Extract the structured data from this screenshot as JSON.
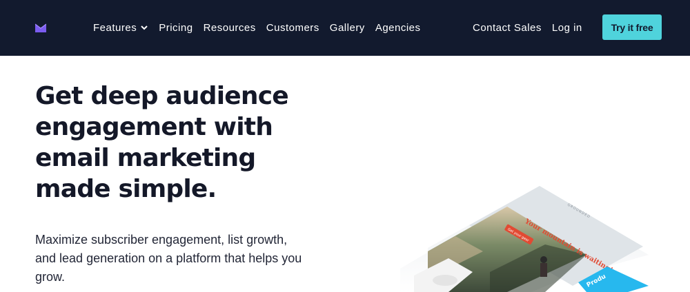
{
  "nav": {
    "items": [
      {
        "label": "Features",
        "has_dropdown": true
      },
      {
        "label": "Pricing"
      },
      {
        "label": "Resources"
      },
      {
        "label": "Customers"
      },
      {
        "label": "Gallery"
      },
      {
        "label": "Agencies"
      }
    ],
    "contact_sales": "Contact Sales",
    "login": "Log in",
    "cta": "Try it free"
  },
  "hero": {
    "title_lines": [
      "Get deep audience",
      "engagement with",
      "email marketing",
      "made simple."
    ],
    "subtitle_lines": [
      "Maximize subscriber engagement, list growth,",
      "and lead generation on a platform that helps you",
      "grow."
    ]
  },
  "illustration": {
    "email_headline": "Your mountain is waiting!",
    "email_button": "Get your gear",
    "brand_small": "GROUNDED",
    "side_card_text": "Produ"
  },
  "colors": {
    "nav_bg": "#121a2e",
    "cta_bg": "#4fd3dc",
    "logo": "#7b5cf0",
    "headline_red": "#e14a33"
  }
}
